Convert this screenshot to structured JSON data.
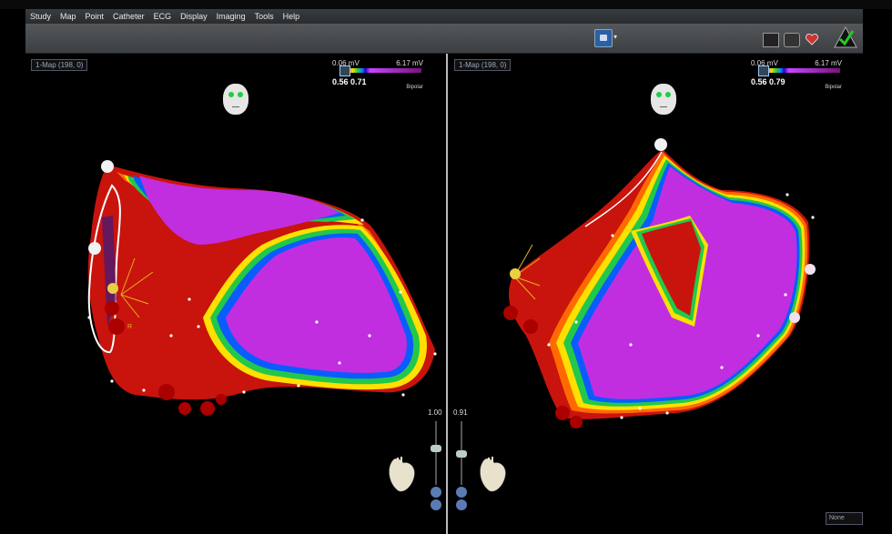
{
  "menu": [
    "Study",
    "Map",
    "Point",
    "Catheter",
    "ECG",
    "Display",
    "Imaging",
    "Tools",
    "Help"
  ],
  "left": {
    "map_select": "1-Map (198, 0)",
    "scale": {
      "low": "0.06 mV",
      "high": "6.17 mV",
      "values": "0.56 0.71",
      "mode": "Bipolar"
    },
    "slider_value": "1.00"
  },
  "right": {
    "map_select": "1-Map (198, 0)",
    "scale": {
      "low": "0.06 mV",
      "high": "6.17 mV",
      "values": "0.56 0.79",
      "mode": "Bipolar"
    },
    "slider_value": "0.91"
  },
  "none_select": "None",
  "colors": {
    "scar": "#c8140c",
    "border_orange": "#ff6a00",
    "border_yellow": "#ffe000",
    "border_green": "#22c84a",
    "border_blue": "#0a5cff",
    "deep_blue": "#2412c8",
    "healthy": "#c12ee0"
  }
}
